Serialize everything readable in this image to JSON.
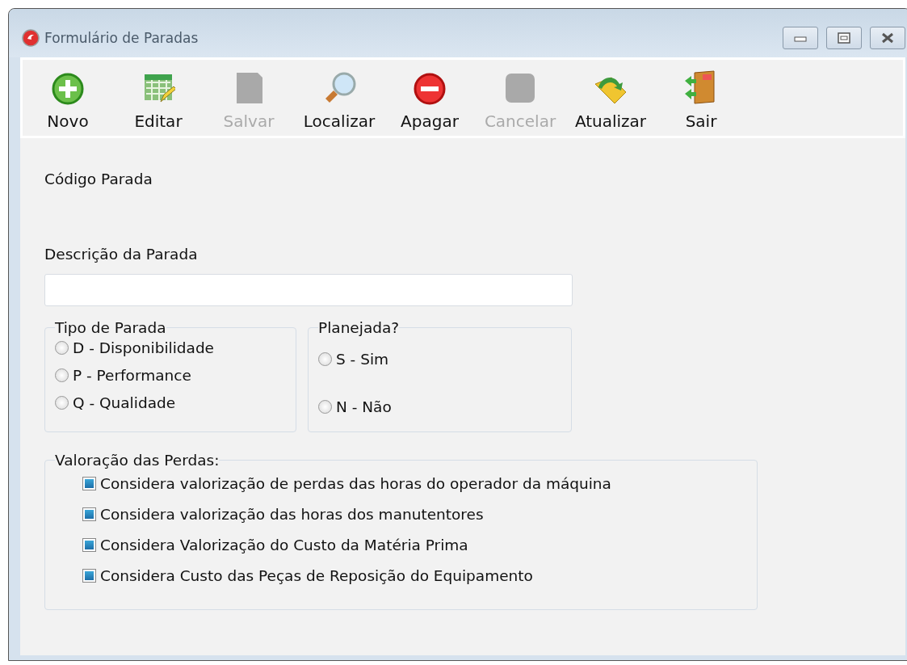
{
  "window": {
    "title": "Formulário de Paradas"
  },
  "toolbar": [
    {
      "label": "Novo",
      "kind": "add",
      "disabled": false
    },
    {
      "label": "Editar",
      "kind": "edit",
      "disabled": false
    },
    {
      "label": "Salvar",
      "kind": "save",
      "disabled": true
    },
    {
      "label": "Localizar",
      "kind": "search",
      "disabled": false
    },
    {
      "label": "Apagar",
      "kind": "delete",
      "disabled": false
    },
    {
      "label": "Cancelar",
      "kind": "cancel",
      "disabled": true
    },
    {
      "label": "Atualizar",
      "kind": "refresh",
      "disabled": false
    },
    {
      "label": "Sair",
      "kind": "exit",
      "disabled": false
    }
  ],
  "codigo": {
    "label": "Código Parada"
  },
  "descricao": {
    "label": "Descrição da Parada"
  },
  "tipo": {
    "title": "Tipo de Parada",
    "options": [
      {
        "label": "D - Disponibilidade",
        "selected": false
      },
      {
        "label": "P - Performance",
        "selected": false
      },
      {
        "label": "Q - Qualidade",
        "selected": false
      }
    ]
  },
  "planejada": {
    "title": "Planejada?",
    "options": [
      {
        "label": "S - Sim",
        "selected": false
      },
      {
        "label": "N - Não",
        "selected": false
      }
    ]
  },
  "valoracao": {
    "title": "Valoração das Perdas:",
    "options": [
      {
        "label": "Considera valorização de perdas das horas do operador da máquina",
        "indeterminate": true
      },
      {
        "label": "Considera valorização das horas dos manutentores",
        "indeterminate": true
      },
      {
        "label": "Considera Valorização do Custo da Matéria Prima",
        "indeterminate": true
      },
      {
        "label": "Considera Custo das Peças de Reposição do Equipamento",
        "indeterminate": true
      }
    ]
  }
}
